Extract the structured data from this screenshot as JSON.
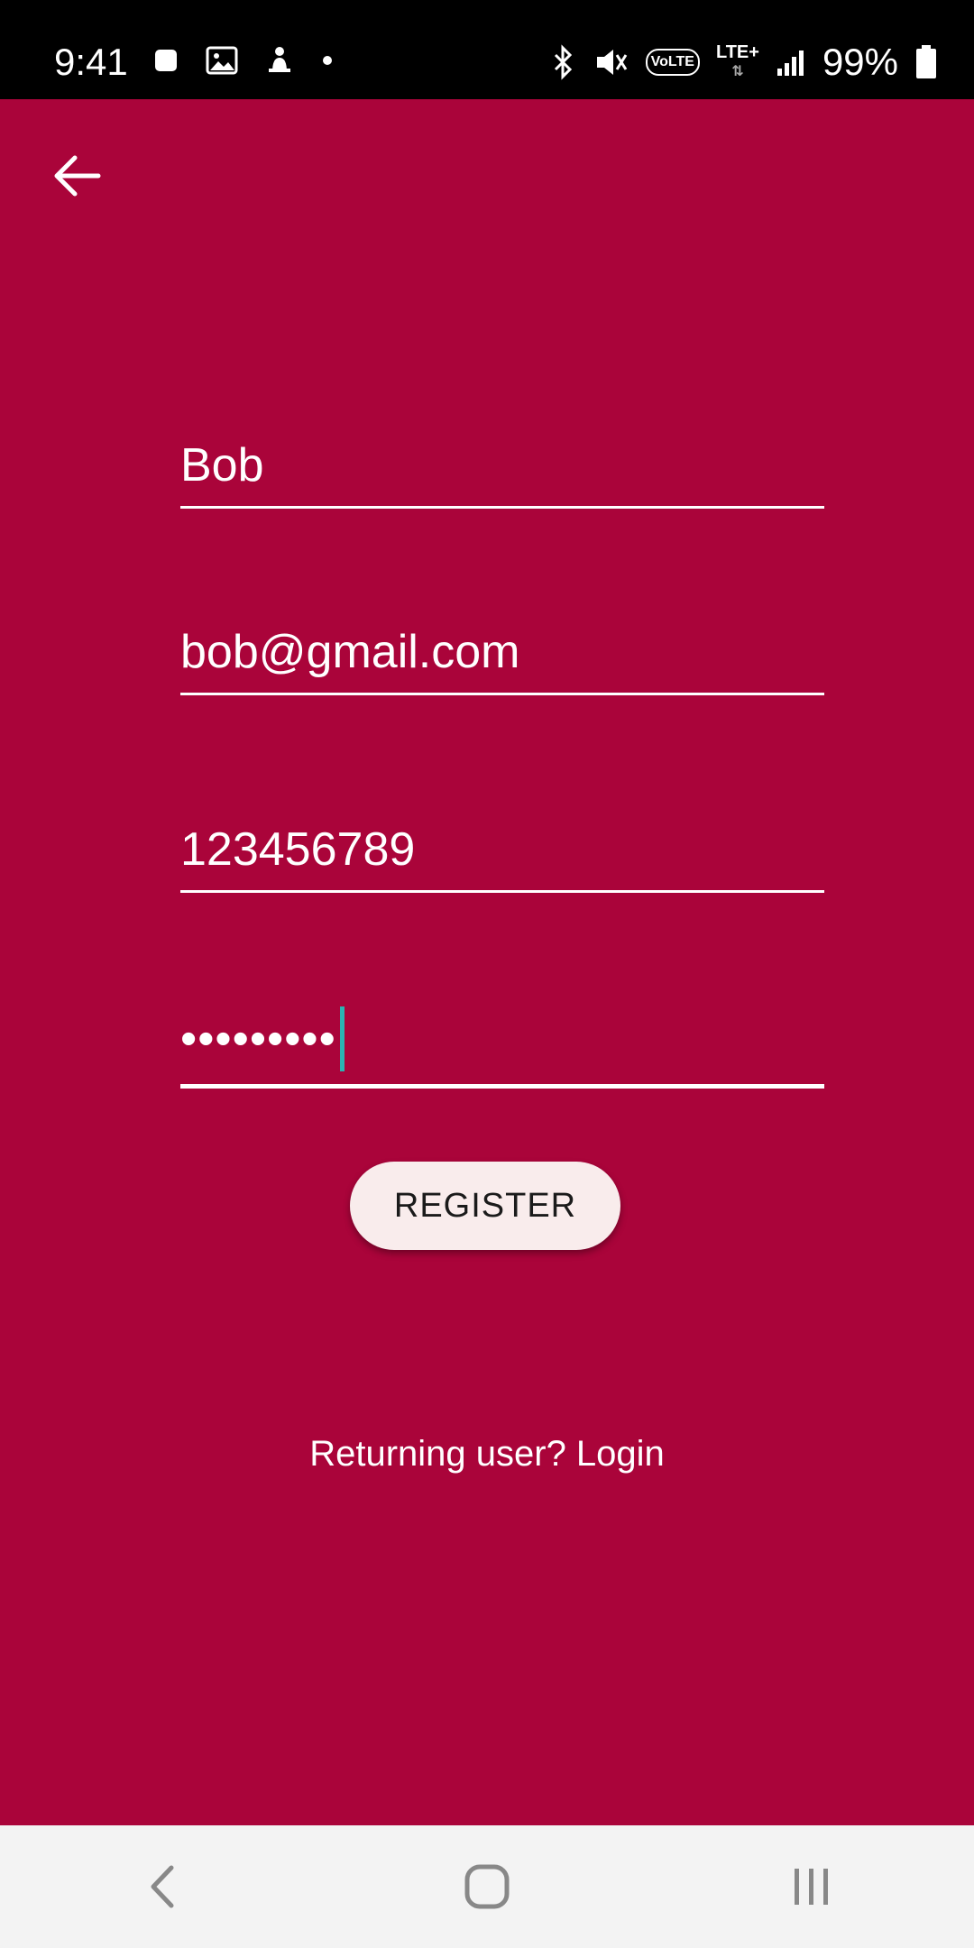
{
  "status_bar": {
    "time": "9:41",
    "left_icons": [
      "app-square-icon",
      "image-icon",
      "notification-icon",
      "dot-icon"
    ],
    "right_icons": [
      "bluetooth-icon",
      "mute-icon",
      "volte-icon",
      "lte-icon",
      "signal-icon",
      "battery-icon"
    ],
    "volte_label": "VoLTE",
    "lte_label": "LTE+",
    "battery": "99%"
  },
  "form": {
    "name_value": "Bob",
    "email_value": "bob@gmail.com",
    "phone_value": "123456789",
    "password_masked": "•••••••••"
  },
  "register_label": "REGISTER",
  "login_link": "Returning user? Login",
  "navigation": {
    "buttons": [
      "back-icon",
      "home-icon",
      "recents-icon"
    ]
  },
  "colors": {
    "background": "#AA043A",
    "button_bg": "#F9ECEC",
    "caret": "#2BB3B3",
    "nav_bar": "#F3F3F3"
  }
}
